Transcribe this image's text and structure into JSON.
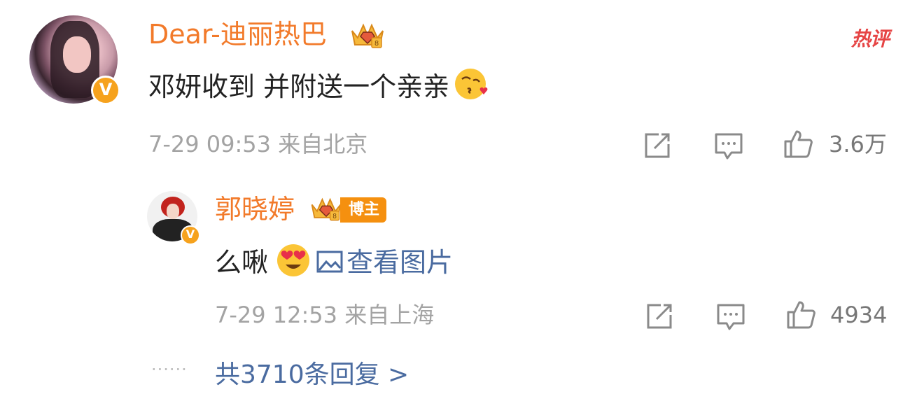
{
  "hot_label": "热评",
  "comment": {
    "username": "Dear-迪丽热巴",
    "text": "邓妍收到 并附送一个亲亲",
    "meta": "7-29 09:53 来自北京",
    "like_count": "3.6万",
    "verified_badge": "V",
    "icons": [
      "share-icon",
      "comment-icon",
      "like-icon"
    ]
  },
  "reply": {
    "username": "郭晓婷",
    "badge_label": "博主",
    "text": "么啾",
    "view_image_label": "查看图片",
    "meta": "7-29 12:53 来自上海",
    "like_count": "4934",
    "verified_badge": "V"
  },
  "more_replies": {
    "dots": "······",
    "label": "共3710条回复 >"
  },
  "colors": {
    "username": "#f27a2a",
    "link": "#4a6ba0",
    "meta": "#a3a3a3",
    "hot": "#e64545",
    "badge": "#f5900f"
  }
}
